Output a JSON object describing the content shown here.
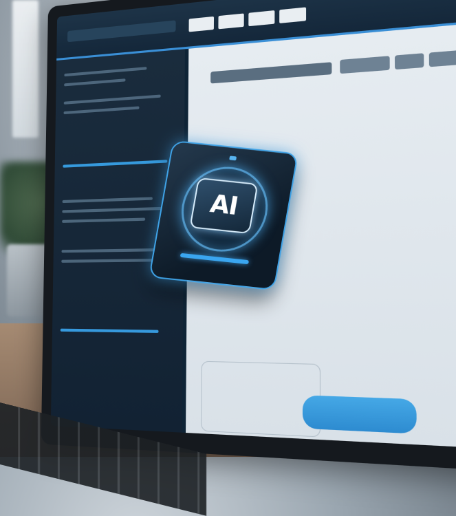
{
  "scene": {
    "accent_color": "#3aa6f0",
    "screen_color": "#0f2436",
    "card_color": "#0d1a27"
  },
  "ai_card": {
    "label": "AI",
    "icon": "ai-chip-icon"
  },
  "topbar": {
    "tabs": [
      "",
      "",
      "",
      ""
    ]
  },
  "main": {
    "send_button_label": ""
  }
}
